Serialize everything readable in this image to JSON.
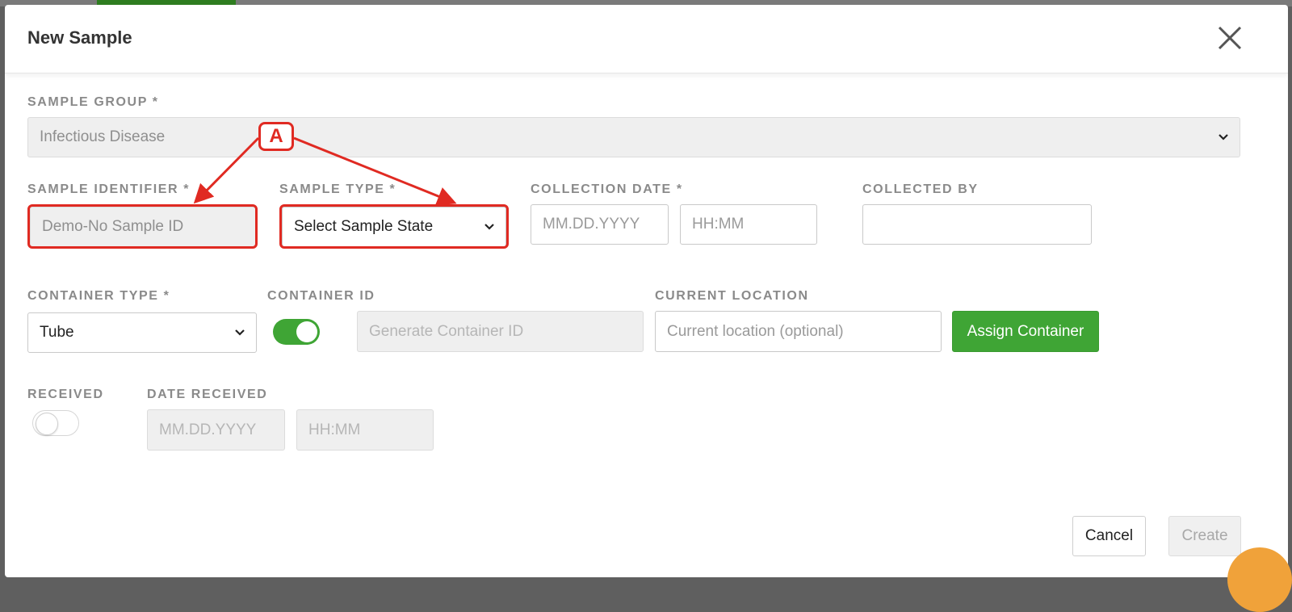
{
  "modal": {
    "title": "New Sample",
    "close_icon": "close-icon"
  },
  "sample_group": {
    "label": "SAMPLE GROUP *",
    "value": "Infectious Disease"
  },
  "sample_identifier": {
    "label": "SAMPLE IDENTIFIER *",
    "value": "Demo-No Sample ID"
  },
  "sample_type": {
    "label": "SAMPLE TYPE *",
    "value": "Select Sample State"
  },
  "collection_date": {
    "label": "COLLECTION DATE *",
    "date_placeholder": "MM.DD.YYYY",
    "time_placeholder": "HH:MM"
  },
  "collected_by": {
    "label": "COLLECTED BY",
    "value": ""
  },
  "container_type": {
    "label": "CONTAINER TYPE *",
    "value": "Tube"
  },
  "container_id": {
    "label": "CONTAINER ID",
    "toggle_on": true,
    "placeholder": "Generate Container ID"
  },
  "current_location": {
    "label": "CURRENT LOCATION",
    "placeholder": "Current location (optional)"
  },
  "assign_container": {
    "label": "Assign Container"
  },
  "received": {
    "label": "RECEIVED",
    "toggle_on": false
  },
  "date_received": {
    "label": "DATE RECEIVED",
    "date_placeholder": "MM.DD.YYYY",
    "time_placeholder": "HH:MM"
  },
  "footer": {
    "cancel_label": "Cancel",
    "create_label": "Create"
  },
  "annotation": {
    "badge": "A",
    "color": "#e02a22"
  },
  "colors": {
    "accent_green": "#3fa535",
    "annotation_red": "#e02a22"
  }
}
